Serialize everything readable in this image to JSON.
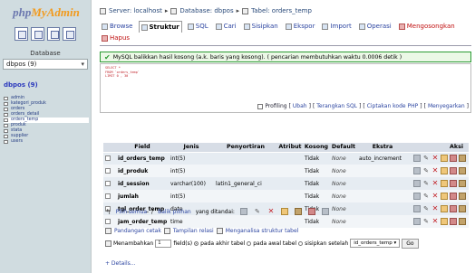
{
  "nav": {
    "logo_part1": "php",
    "logo_part2": "MyAdmin",
    "database_label": "Database",
    "database_select": "dbpos (9)",
    "database_link": "dbpos (9)",
    "tables": [
      "admin",
      "kategori_produk",
      "orders",
      "orders_detail",
      "orders_temp",
      "produk",
      "stata",
      "supplier",
      "users"
    ],
    "active_table": "orders_temp"
  },
  "breadcrumb": {
    "server": "Server: localhost",
    "database": "Database: dbpos",
    "table": "Tabel: orders_temp"
  },
  "tabs": [
    {
      "label": "Browse",
      "icon": "browse-icon"
    },
    {
      "label": "Struktur",
      "icon": "structure-icon",
      "active": true
    },
    {
      "label": "SQL",
      "icon": "sql-icon"
    },
    {
      "label": "Cari",
      "icon": "search-icon"
    },
    {
      "label": "Sisipkan",
      "icon": "insert-icon"
    },
    {
      "label": "Ekspor",
      "icon": "export-icon"
    },
    {
      "label": "Import",
      "icon": "import-icon"
    },
    {
      "label": "Operasi",
      "icon": "operations-icon"
    },
    {
      "label": "Mengosongkan",
      "icon": "empty-icon",
      "danger": true
    },
    {
      "label": "Hapus",
      "icon": "drop-icon",
      "danger": true
    }
  ],
  "message": "MySQL balikkan hasil kosong (a.k. baris yang kosong). ( pencarian membutuhkan waktu 0.0006 detik )",
  "sql_lines": [
    "SELECT *",
    "FROM `orders_temp`",
    "LIMIT 0 , 30"
  ],
  "sql_links": {
    "profiling": "Profiling",
    "ubah": "Ubah",
    "terangkan": "Terangkan SQL",
    "ciptakan": "Ciptakan kode PHP",
    "menyegarkan": "Menyegarkan"
  },
  "table": {
    "headers": [
      "Field",
      "Jenis",
      "Penyortiran",
      "Atribut",
      "Kosong",
      "Default",
      "Ekstra",
      "Aksi"
    ],
    "rows": [
      {
        "field": "id_orders_temp",
        "jenis": "int(5)",
        "penyortiran": "",
        "atribut": "",
        "kosong": "Tidak",
        "default": "None",
        "ekstra": "auto_increment"
      },
      {
        "field": "id_produk",
        "jenis": "int(5)",
        "penyortiran": "",
        "atribut": "",
        "kosong": "Tidak",
        "default": "None",
        "ekstra": ""
      },
      {
        "field": "id_session",
        "jenis": "varchar(100)",
        "penyortiran": "latin1_general_ci",
        "atribut": "",
        "kosong": "Tidak",
        "default": "None",
        "ekstra": ""
      },
      {
        "field": "jumlah",
        "jenis": "int(5)",
        "penyortiran": "",
        "atribut": "",
        "kosong": "Tidak",
        "default": "None",
        "ekstra": ""
      },
      {
        "field": "tgl_order_temp",
        "jenis": "date",
        "penyortiran": "",
        "atribut": "",
        "kosong": "Tidak",
        "default": "None",
        "ekstra": ""
      },
      {
        "field": "jam_order_temp",
        "jenis": "time",
        "penyortiran": "",
        "atribut": "",
        "kosong": "Tidak",
        "default": "None",
        "ekstra": ""
      }
    ]
  },
  "bulk": {
    "check_all": "Pilih semua",
    "separator": "/",
    "uncheck_all": "Balik pilihan",
    "with_selected": "yang ditandai:"
  },
  "footer": {
    "print_view": "Pandangan cetak",
    "relation_view": "Tampilan relasi",
    "propose": "Menganalisa struktur tabel"
  },
  "addrow": {
    "label": "Menambahkan",
    "count": "1",
    "field_label": "field(s)",
    "opt_end": "pada akhir tabel",
    "opt_begin": "pada awal tabel",
    "opt_after": "sisipkan setelah",
    "after_select": "id_orders_temp",
    "go": "Go"
  },
  "details": "+ Details..."
}
